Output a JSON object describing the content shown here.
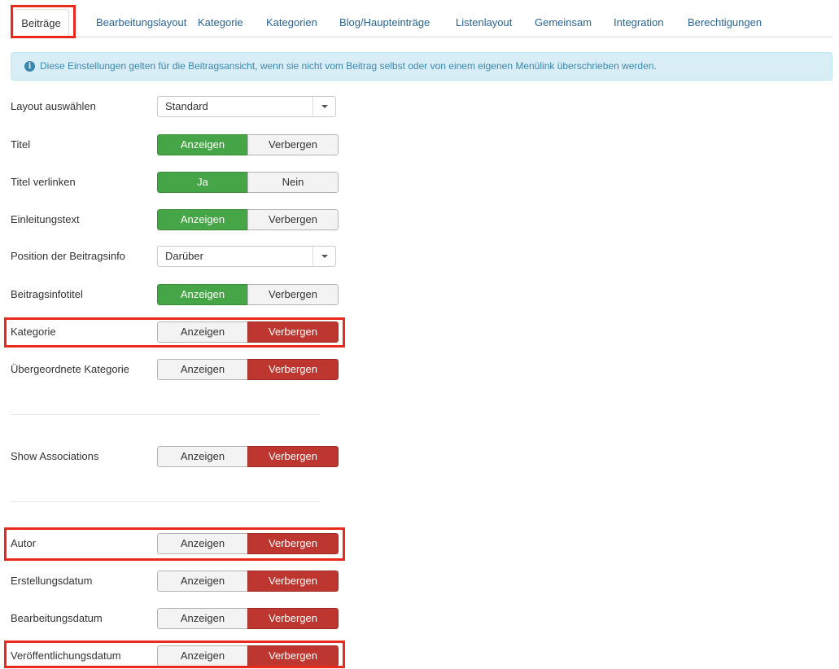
{
  "tabs": [
    {
      "label": "Beiträge"
    },
    {
      "label": "Bearbeitungslayout"
    },
    {
      "label": "Kategorie"
    },
    {
      "label": "Kategorien"
    },
    {
      "label": "Blog/Haupteinträge"
    },
    {
      "label": "Listenlayout"
    },
    {
      "label": "Gemeinsam"
    },
    {
      "label": "Integration"
    },
    {
      "label": "Berechtigungen"
    }
  ],
  "alert": {
    "icon": "info-icon",
    "text": "Diese Einstellungen gelten für die Beitragsansicht, wenn sie nicht vom Beitrag selbst oder von einem eigenen Menülink überschrieben werden."
  },
  "fields": [
    {
      "label": "Layout auswählen",
      "value": "Standard"
    },
    {
      "label": "Titel",
      "options": [
        "Anzeigen",
        "Verbergen"
      ],
      "selected": "Anzeigen"
    },
    {
      "label": "Titel verlinken",
      "options": [
        "Ja",
        "Nein"
      ],
      "selected": "Ja"
    },
    {
      "label": "Einleitungstext",
      "options": [
        "Anzeigen",
        "Verbergen"
      ],
      "selected": "Anzeigen"
    },
    {
      "label": "Position der Beitragsinfo",
      "value": "Darüber"
    },
    {
      "label": "Beitragsinfotitel",
      "options": [
        "Anzeigen",
        "Verbergen"
      ],
      "selected": "Anzeigen"
    },
    {
      "label": "Kategorie",
      "options": [
        "Anzeigen",
        "Verbergen"
      ],
      "selected": "Verbergen"
    },
    {
      "label": "Übergeordnete Kategorie",
      "options": [
        "Anzeigen",
        "Verbergen"
      ],
      "selected": "Verbergen"
    },
    {
      "label": "Show Associations",
      "options": [
        "Anzeigen",
        "Verbergen"
      ],
      "selected": "Verbergen"
    },
    {
      "label": "Autor",
      "options": [
        "Anzeigen",
        "Verbergen"
      ],
      "selected": "Verbergen"
    },
    {
      "label": "Erstellungsdatum",
      "options": [
        "Anzeigen",
        "Verbergen"
      ],
      "selected": "Verbergen"
    },
    {
      "label": "Bearbeitungsdatum",
      "options": [
        "Anzeigen",
        "Verbergen"
      ],
      "selected": "Verbergen"
    },
    {
      "label": "Veröffentlichungsdatum",
      "options": [
        "Anzeigen",
        "Verbergen"
      ],
      "selected": "Verbergen"
    }
  ],
  "colors": {
    "show_active": "#46a546",
    "hide_active": "#bd362f",
    "highlight": "#e8291c",
    "link": "#2a6496"
  }
}
